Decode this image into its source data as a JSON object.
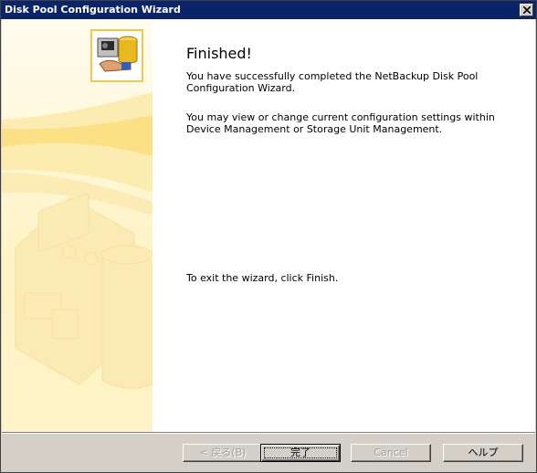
{
  "window": {
    "title": "Disk Pool Configuration Wizard",
    "close_symbol": "✕"
  },
  "main": {
    "heading": "Finished!",
    "paragraph1": "You have successfully completed the NetBackup Disk Pool Configuration Wizard.",
    "paragraph2": "You may view or change current configuration settings within Device Management or Storage Unit Management.",
    "paragraph3": "To exit the wizard, click Finish."
  },
  "buttons": {
    "back": "< 戻る(B)",
    "finish": "完了",
    "cancel": "Cancel",
    "help": "ヘルプ"
  },
  "icons": {
    "logo": "disk-pool-wizard-icon",
    "close": "close-icon"
  },
  "colors": {
    "titlebar": "#0a246a",
    "accent": "#f3c74d",
    "dialog_face": "#d4d0c8"
  }
}
